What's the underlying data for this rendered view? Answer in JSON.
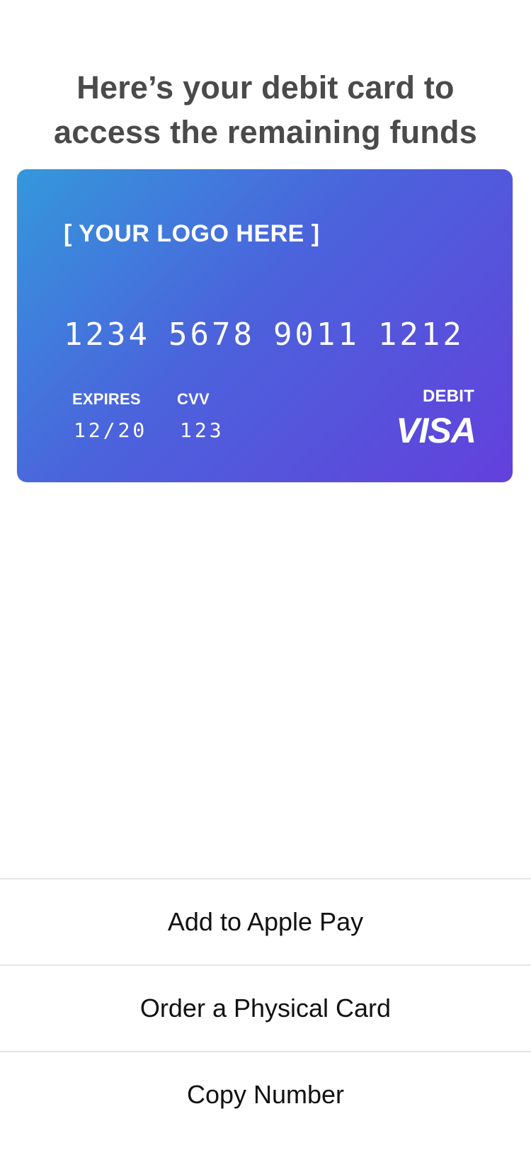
{
  "header": {
    "line1": "Here’s your debit card to",
    "line2": "access the remaining funds"
  },
  "card": {
    "logo_text": "[ YOUR LOGO HERE ]",
    "number_groups": [
      "1234",
      "5678",
      "9011",
      "1212"
    ],
    "expires_label": "EXPIRES",
    "expires_value": "12/20",
    "cvv_label": "CVV",
    "cvv_value": "123",
    "debit_label": "DEBIT",
    "brand": "VISA",
    "gradient_start": "#3498db",
    "gradient_end": "#6340dc"
  },
  "actions": {
    "apple_pay": "Add to Apple Pay",
    "order_physical": "Order a Physical Card",
    "copy_number": "Copy Number"
  }
}
